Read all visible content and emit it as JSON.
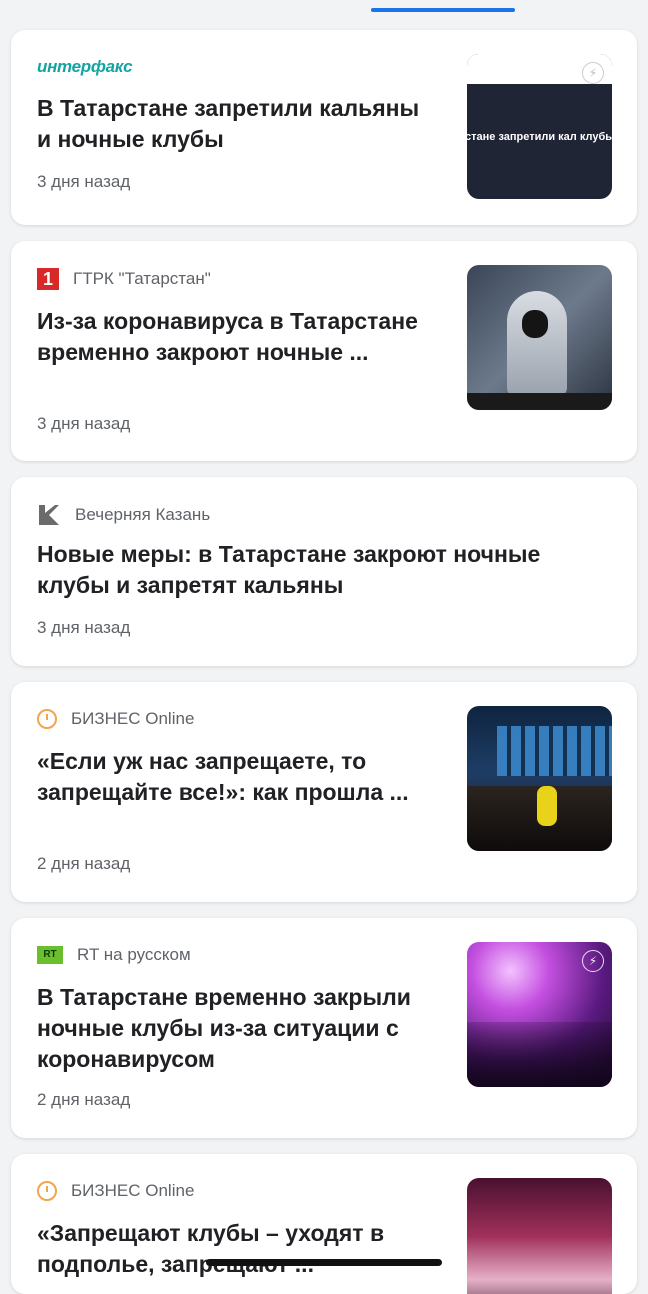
{
  "cards": [
    {
      "source": "интерфакс",
      "headline": "В Татарстане запретили кальяны и ночные клубы",
      "time": "3 дня назад",
      "thumb_text": "стане запретили кал клубы"
    },
    {
      "source": "ГТРК \"Татарстан\"",
      "headline": "Из-за коронавируса в Татарстане временно закроют ночные ...",
      "time": "3 дня назад",
      "logo_char": "1"
    },
    {
      "source": "Вечерняя Казань",
      "headline": "Новые меры: в Татарстане закроют ночные клубы и запретят кальяны",
      "time": "3 дня назад"
    },
    {
      "source": "БИЗНЕС Online",
      "headline": "«Если уж нас запрещаете, то запрещайте все!»: как прошла ...",
      "time": "2 дня назад"
    },
    {
      "source": "RT на русском",
      "headline": "В Татарстане временно закрыли ночные клубы из-за ситуации с коронавирусом",
      "time": "2 дня назад",
      "logo_char": "RT"
    },
    {
      "source": "БИЗНЕС Online",
      "headline": "«Запрещают клубы – уходят в подполье, запрещают ..."
    }
  ],
  "colors": {
    "accent": "#1a73e8",
    "headline": "#202124",
    "meta": "#5f6368"
  }
}
